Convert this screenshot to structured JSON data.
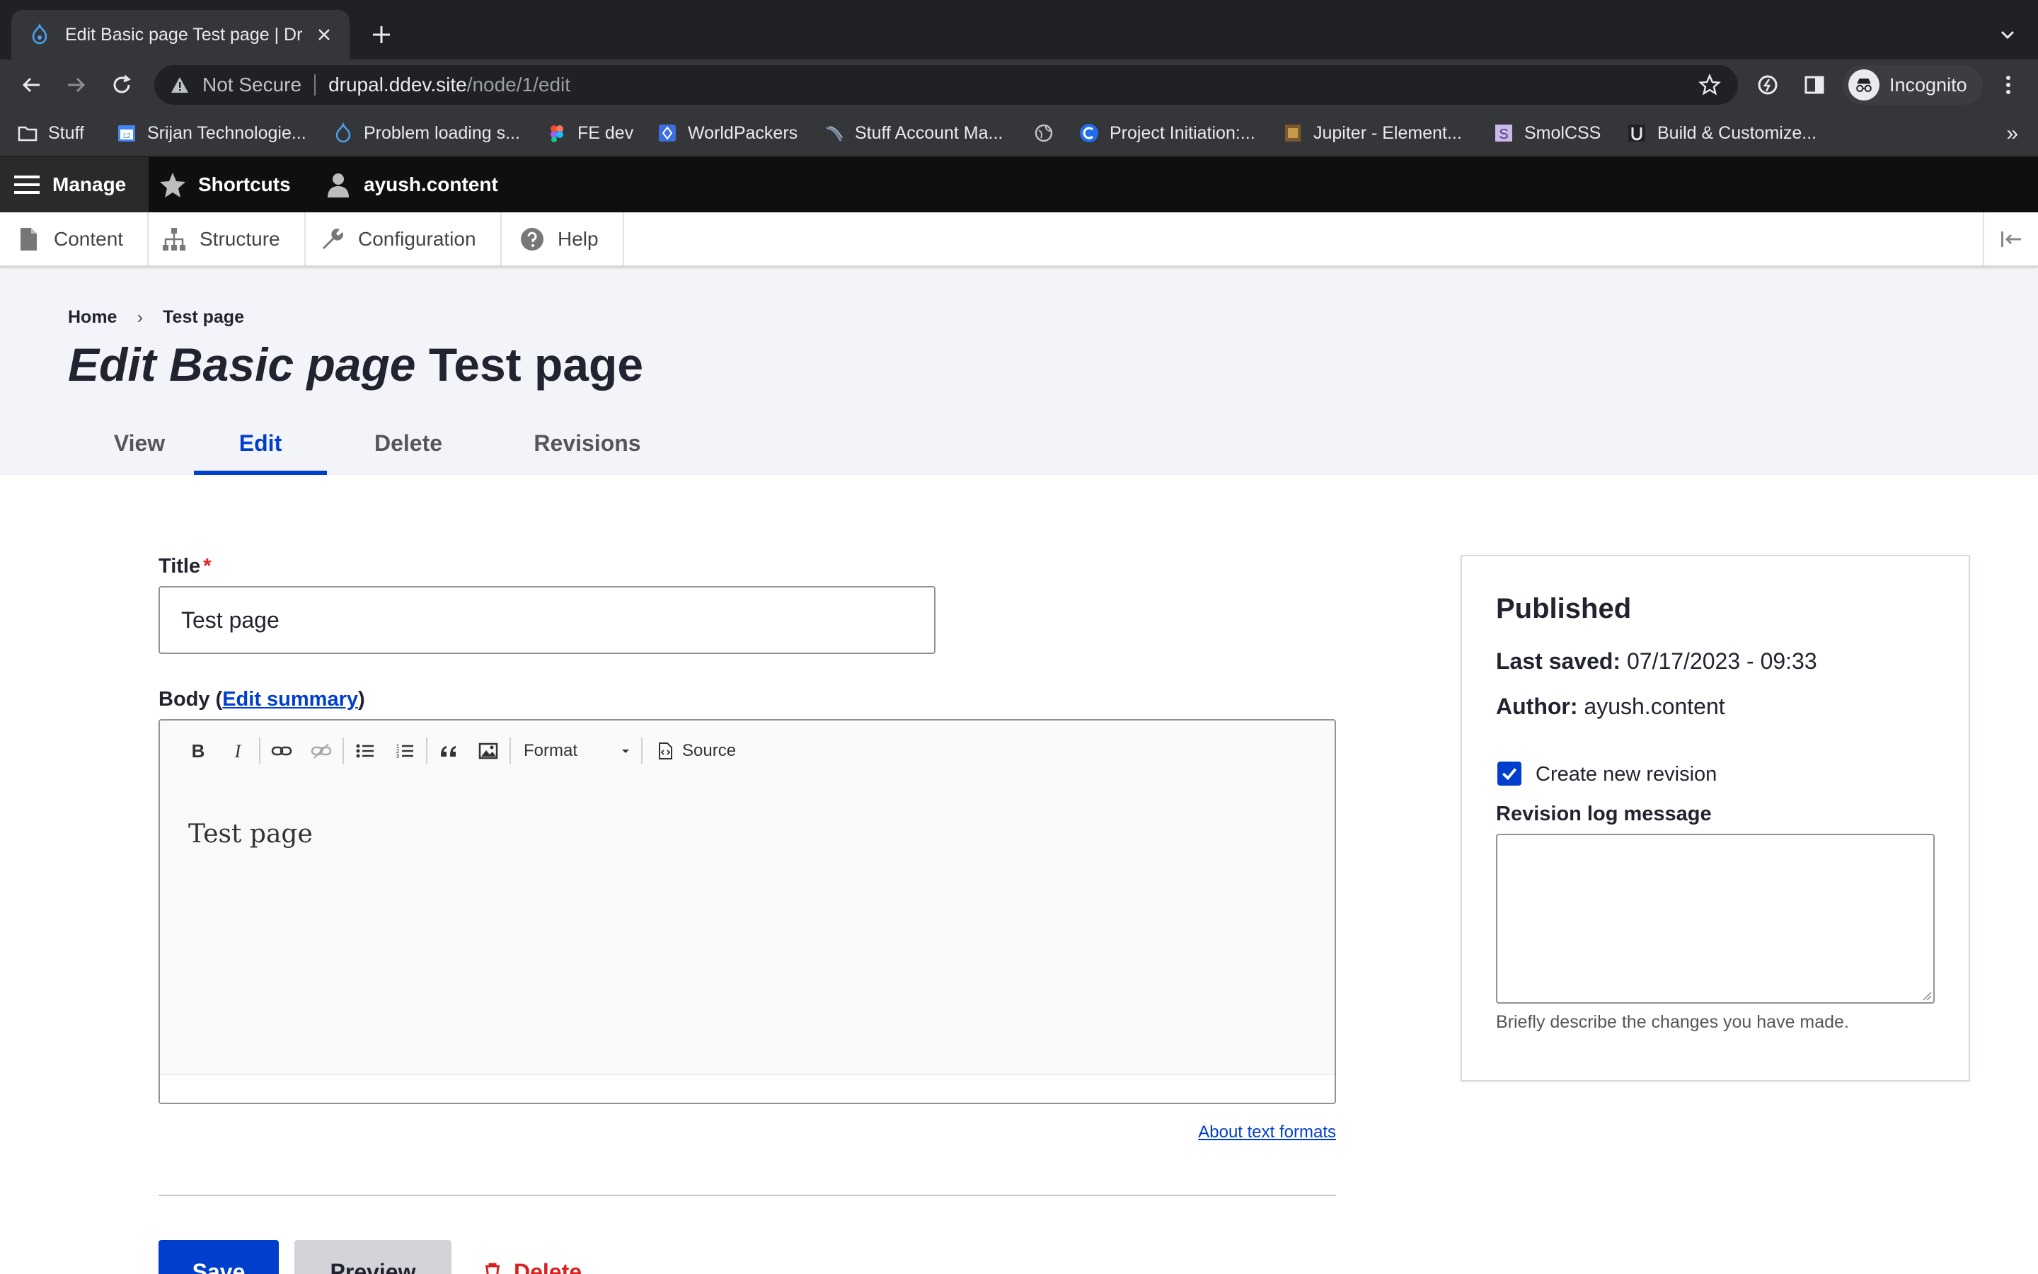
{
  "browser": {
    "tab_title": "Edit Basic page Test page | Dru",
    "url_security": "Not Secure",
    "url_host": "drupal.ddev.site",
    "url_path": "/node/1/edit",
    "profile_label": "Incognito",
    "bookmarks": [
      {
        "label": "Stuff",
        "icon": "folder-icon"
      },
      {
        "label": "Srijan Technologie...",
        "icon": "calendar-icon"
      },
      {
        "label": "Problem loading s...",
        "icon": "drupal-icon"
      },
      {
        "label": "FE dev",
        "icon": "figma-icon"
      },
      {
        "label": "WorldPackers",
        "icon": "worldpackers-icon"
      },
      {
        "label": "Stuff Account Ma...",
        "icon": "wave-icon"
      },
      {
        "label": "",
        "icon": "globe-icon"
      },
      {
        "label": "Project Initiation:...",
        "icon": "c-icon"
      },
      {
        "label": "Jupiter - Element...",
        "icon": "jupiter-icon"
      },
      {
        "label": "SmolCSS",
        "icon": "s-icon"
      },
      {
        "label": "Build & Customize...",
        "icon": "u-icon"
      }
    ],
    "bookmarks_overflow": "»"
  },
  "admin_toolbar": {
    "manage": "Manage",
    "shortcuts": "Shortcuts",
    "user": "ayush.content",
    "tray": {
      "content": "Content",
      "structure": "Structure",
      "configuration": "Configuration",
      "help": "Help"
    }
  },
  "header": {
    "breadcrumb_home": "Home",
    "breadcrumb_current": "Test page",
    "title_type": "Edit Basic page",
    "title_name": "Test page",
    "tabs": {
      "view": "View",
      "edit": "Edit",
      "delete": "Delete",
      "revisions": "Revisions"
    }
  },
  "form": {
    "title_label": "Title",
    "required_mark": "*",
    "title_value": "Test page",
    "body_label_prefix": "Body (",
    "body_edit_summary": "Edit summary",
    "body_label_suffix": ")",
    "editor": {
      "format_label": "Format",
      "source_label": "Source",
      "content": "Test page"
    },
    "about_text_formats": "About text formats",
    "actions": {
      "save": "Save",
      "preview": "Preview",
      "delete": "Delete"
    }
  },
  "sidebar": {
    "status": "Published",
    "last_saved_label": "Last saved:",
    "last_saved_value": "07/17/2023 - 09:33",
    "author_label": "Author:",
    "author_value": "ayush.content",
    "create_revision_label": "Create new revision",
    "create_revision_checked": true,
    "revision_log_label": "Revision log message",
    "revision_log_value": "",
    "revision_log_description": "Briefly describe the changes you have made."
  },
  "colors": {
    "accent": "#003ecc",
    "danger": "#d72222",
    "header_bg": "#f3f4f9",
    "admin_bar_bg": "#0f0f0f",
    "browser_bg": "#35363a"
  }
}
